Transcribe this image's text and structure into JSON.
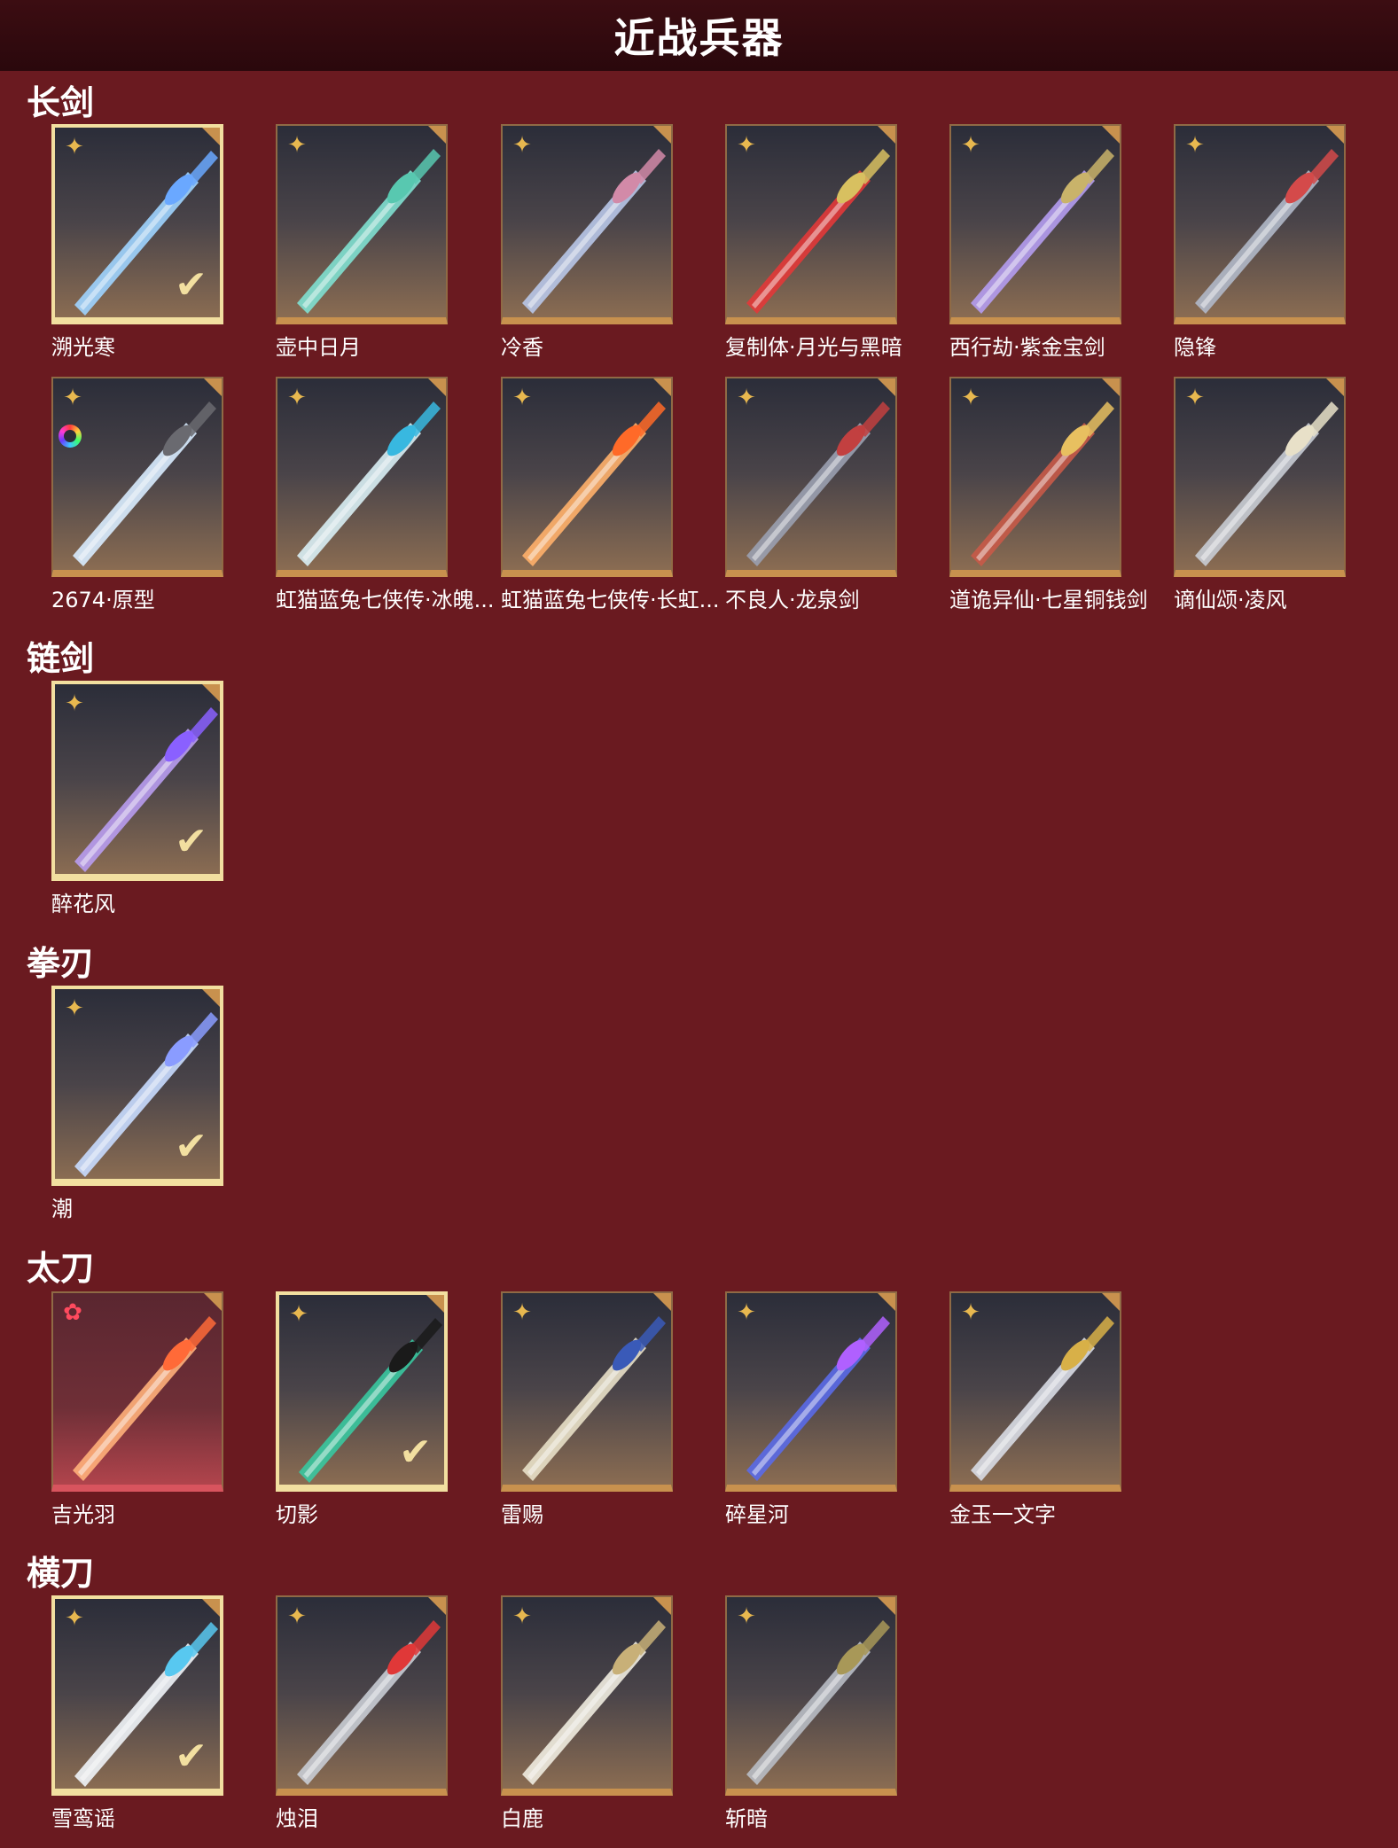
{
  "header": {
    "title": "近战兵器"
  },
  "sections": [
    {
      "title": "长剑",
      "items": [
        {
          "name": "溯光寒",
          "selected": true,
          "badge": "sparkle-icon",
          "blade": "#9fd4ff",
          "accent": "#6aa8ff"
        },
        {
          "name": "壶中日月",
          "selected": false,
          "badge": "sparkle-icon",
          "blade": "#7fe0d0",
          "accent": "#58c8b0"
        },
        {
          "name": "冷香",
          "selected": false,
          "badge": "sparkle-icon",
          "blade": "#b8c6e8",
          "accent": "#d28aa8"
        },
        {
          "name": "复制体·月光与黑暗",
          "selected": false,
          "badge": "sparkle-icon",
          "blade": "#e23838",
          "accent": "#d8c060"
        },
        {
          "name": "西行劫·紫金宝剑",
          "selected": false,
          "badge": "sparkle-icon",
          "blade": "#b49cf0",
          "accent": "#c9b36a"
        },
        {
          "name": "隐锋",
          "selected": false,
          "badge": "sparkle-icon",
          "blade": "#b0b8c8",
          "accent": "#d44a4a"
        },
        {
          "name": "2674·原型",
          "selected": false,
          "badge": "sparkle-icon",
          "ring": true,
          "blade": "#d8ecff",
          "accent": "#6a6a70"
        },
        {
          "name": "虹猫蓝兔七侠传·冰魄...",
          "selected": false,
          "badge": "sparkle-icon",
          "blade": "#d8eef4",
          "accent": "#38b8e0"
        },
        {
          "name": "虹猫蓝兔七侠传·长虹...",
          "selected": false,
          "badge": "sparkle-icon",
          "blade": "#ffb06a",
          "accent": "#ff6a28"
        },
        {
          "name": "不良人·龙泉剑",
          "selected": false,
          "badge": "sparkle-icon",
          "blade": "#9aa0b0",
          "accent": "#c24040"
        },
        {
          "name": "道诡异仙·七星铜钱剑",
          "selected": false,
          "badge": "sparkle-icon",
          "blade": "#c85a48",
          "accent": "#e8c060"
        },
        {
          "name": "谪仙颂·凌风",
          "selected": false,
          "badge": "sparkle-icon",
          "blade": "#c8ccd4",
          "accent": "#e8e0c8"
        }
      ]
    },
    {
      "title": "链剑",
      "items": [
        {
          "name": "醉花风",
          "selected": true,
          "badge": "sparkle-icon",
          "blade": "#b89cf0",
          "accent": "#8a60ff"
        }
      ]
    },
    {
      "title": "拳刃",
      "items": [
        {
          "name": "潮",
          "selected": true,
          "badge": "sparkle-icon",
          "blade": "#c8dcff",
          "accent": "#8a9cff"
        }
      ]
    },
    {
      "title": "太刀",
      "items": [
        {
          "name": "吉光羽",
          "selected": false,
          "badge": "red-flower-icon",
          "red": true,
          "blade": "#ffb07a",
          "accent": "#ff6a38"
        },
        {
          "name": "切影",
          "selected": true,
          "badge": "sparkle-icon",
          "blade": "#38c8a0",
          "accent": "#1a1a1a"
        },
        {
          "name": "雷赐",
          "selected": false,
          "badge": "sparkle-icon",
          "blade": "#e8e0c8",
          "accent": "#3a5ab8"
        },
        {
          "name": "碎星河",
          "selected": false,
          "badge": "sparkle-icon",
          "blade": "#5a6ae8",
          "accent": "#b060ff"
        },
        {
          "name": "金玉一文字",
          "selected": false,
          "badge": "sparkle-icon",
          "blade": "#d8dce4",
          "accent": "#d8b048"
        }
      ]
    },
    {
      "title": "横刀",
      "items": [
        {
          "name": "雪鸾谣",
          "selected": true,
          "badge": "sparkle-icon",
          "blade": "#f0f4f8",
          "accent": "#58c8f0"
        },
        {
          "name": "烛泪",
          "selected": false,
          "badge": "sparkle-icon",
          "blade": "#c8ccd4",
          "accent": "#e03838"
        },
        {
          "name": "白鹿",
          "selected": false,
          "badge": "sparkle-icon",
          "blade": "#f0ece0",
          "accent": "#c8b078"
        },
        {
          "name": "斩暗",
          "selected": false,
          "badge": "sparkle-icon",
          "blade": "#b8bcc4",
          "accent": "#a89858"
        }
      ]
    }
  ],
  "colors": {
    "background": "#6a1a20",
    "header": "#2a080c",
    "frame_gold": "#c8914e",
    "selected_frame": "#f2dfa0"
  }
}
